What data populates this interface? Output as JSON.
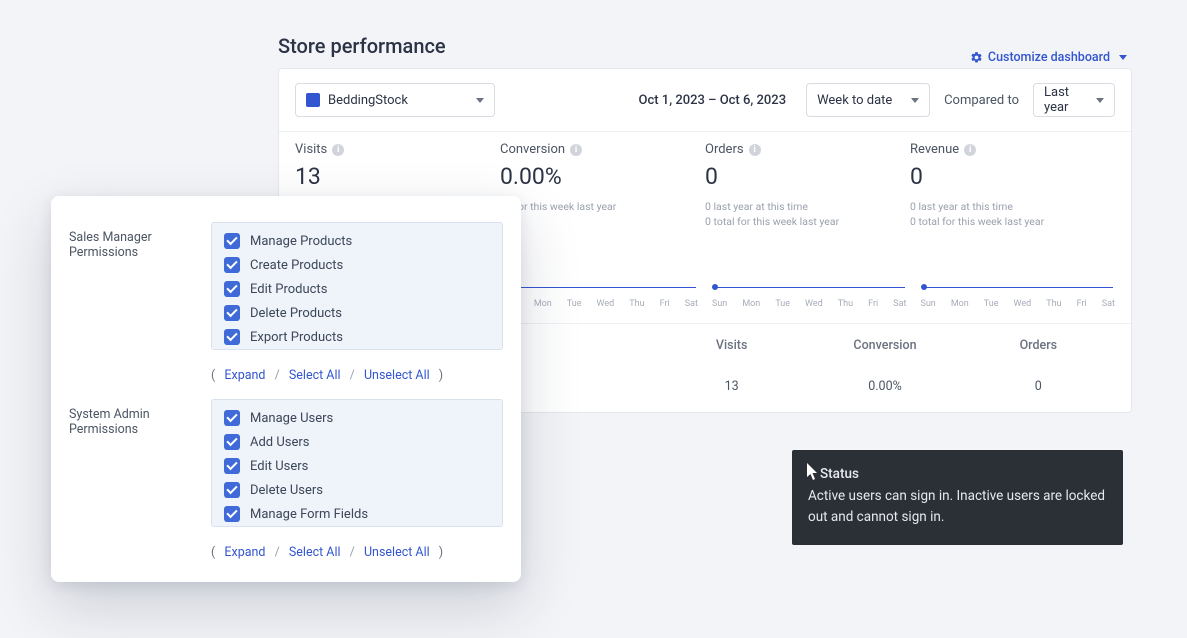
{
  "page_title": "Store performance",
  "customize_label": "Customize dashboard",
  "store_select": {
    "value": "BeddingStock"
  },
  "date_range": "Oct 1, 2023 – Oct 6, 2023",
  "week_select": {
    "value": "Week to date"
  },
  "compared_label": "Compared to",
  "compare_select": {
    "value": "Last year"
  },
  "metrics": {
    "visits": {
      "label": "Visits",
      "value": "13"
    },
    "conversion": {
      "label": "Conversion",
      "value": "0.00%",
      "sub1": "tal for this week last year"
    },
    "orders": {
      "label": "Orders",
      "value": "0",
      "sub1": "0 last year at this time",
      "sub2": "0 total for this week last year"
    },
    "revenue": {
      "label": "Revenue",
      "value": "0",
      "sub1": "0 last year at this time",
      "sub2": "0 total for this week last year"
    }
  },
  "chart_days": [
    "Sun",
    "Mon",
    "Tue",
    "Wed",
    "Thu",
    "Fri",
    "Sat"
  ],
  "table": {
    "headers": {
      "visits": "Visits",
      "conversion": "Conversion",
      "orders": "Orders"
    },
    "row": {
      "visits": "13",
      "conversion": "0.00%",
      "orders": "0"
    }
  },
  "permissions": {
    "sales_title": "Sales Manager Permissions",
    "admin_title": "System Admin Permissions",
    "sales_items": [
      "Manage Products",
      "Create Products",
      "Edit Products",
      "Delete Products",
      "Export Products"
    ],
    "admin_items": [
      "Manage Users",
      "Add Users",
      "Edit Users",
      "Delete Users",
      "Manage Form Fields"
    ],
    "expand": "Expand",
    "select_all": "Select All",
    "unselect_all": "Unselect All"
  },
  "tooltip": {
    "title": "Status",
    "body": "Active users can sign in. Inactive users are locked out and cannot sign in."
  },
  "chart_data": [
    {
      "type": "line",
      "title": "Visits",
      "categories": [
        "Sun",
        "Mon",
        "Tue",
        "Wed",
        "Thu",
        "Fri",
        "Sat"
      ],
      "values": [
        0,
        0,
        0,
        0,
        0,
        0,
        0
      ]
    },
    {
      "type": "line",
      "title": "Conversion",
      "categories": [
        "Sun",
        "Mon",
        "Tue",
        "Wed",
        "Thu",
        "Fri",
        "Sat"
      ],
      "values": [
        0,
        0,
        0,
        0,
        0,
        0,
        0
      ]
    },
    {
      "type": "line",
      "title": "Orders",
      "categories": [
        "Sun",
        "Mon",
        "Tue",
        "Wed",
        "Thu",
        "Fri",
        "Sat"
      ],
      "values": [
        0,
        0,
        0,
        0,
        0,
        0,
        0
      ]
    },
    {
      "type": "line",
      "title": "Revenue",
      "categories": [
        "Sun",
        "Mon",
        "Tue",
        "Wed",
        "Thu",
        "Fri",
        "Sat"
      ],
      "values": [
        0,
        0,
        0,
        0,
        0,
        0,
        0
      ]
    }
  ]
}
